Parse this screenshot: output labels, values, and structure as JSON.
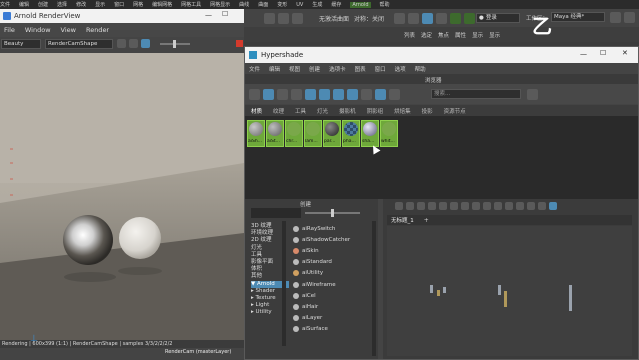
{
  "maya": {
    "menubar": [
      "文件",
      "编辑",
      "创建",
      "选择",
      "修改",
      "显示",
      "窗口",
      "网格",
      "编辑网格",
      "网格工具",
      "网格显示",
      "曲线",
      "曲面",
      "变形",
      "UV",
      "生成",
      "缓存",
      "Arnold",
      "帮助"
    ],
    "no_live_surface": "无激活曲面",
    "symmetry": "对称：关闭",
    "login": "登录",
    "workspace_label": "工作区：",
    "workspace_value": "Maya 经典*",
    "shelf_labels": [
      "列表",
      "选定",
      "焦点",
      "属性",
      "显示",
      "显示"
    ],
    "logo_glyph": "乙"
  },
  "renderview": {
    "title": "Arnold RenderView",
    "menu": [
      "File",
      "Window",
      "View",
      "Render"
    ],
    "aov": "Beauty",
    "camera": "RenderCamShape",
    "status": "Rendering | 600x399 (1:1) | RenderCamShape | samples 3/3/2/2/2/2",
    "camera_caption": "RenderCam (masterLayer)"
  },
  "hypershade": {
    "title": "Hypershade",
    "menu": [
      "文件",
      "编辑",
      "视图",
      "创建",
      "选项卡",
      "图表",
      "窗口",
      "选项",
      "帮助"
    ],
    "browser_label": "浏览器",
    "search_placeholder": "搜索...",
    "tabs": [
      "材质",
      "纹理",
      "工具",
      "灯光",
      "摄影机",
      "阴影组",
      "烘焙集",
      "投影",
      "资源节点"
    ],
    "swatches": [
      {
        "label": "aiSh...",
        "color": "#9a9a9a"
      },
      {
        "label": "aiSt...",
        "color": "#8a8a8a"
      },
      {
        "label": "chr...",
        "color": "#7aa84a"
      },
      {
        "label": "lam...",
        "color": "#7d7d7d"
      },
      {
        "label": "par...",
        "color": "#5e6064"
      },
      {
        "label": "pha...",
        "color": "#4d7aa0"
      },
      {
        "label": "sha...",
        "color": "#b5b5c8"
      },
      {
        "label": "whit...",
        "color": "#d8d8d8"
      }
    ],
    "create_label": "创建",
    "create_categories": [
      "3D 纹理",
      "环境纹理",
      "2D 纹理",
      "灯光",
      "工具",
      "影像平面",
      "体积",
      "其他",
      "▼ Arnold",
      "  ▸ Shader",
      "  ▸ Texture",
      "  ▸ Light",
      "  ▸ Utility"
    ],
    "create_items": [
      "aiRaySwitch",
      "aiShadowCatcher",
      "aiSkin",
      "aiStandard",
      "aiUtility",
      "aiWireframe",
      "aiCel",
      "aiHair",
      "aiLayer",
      "aiSurface"
    ],
    "graph_tab": "无标题_1",
    "graph_tab_add": "+"
  },
  "colors": {
    "accent": "#4d8ab3",
    "swatch_bg": "#6ea83a",
    "render_record": "#d33a2c"
  }
}
